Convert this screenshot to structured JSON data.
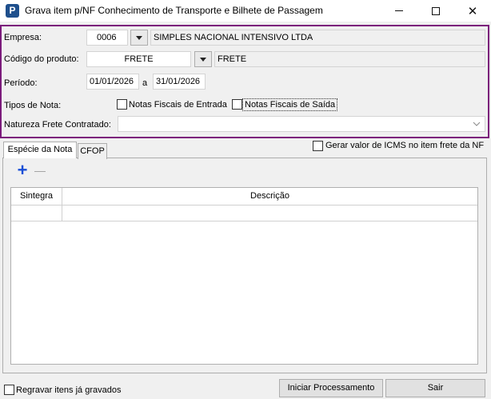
{
  "window": {
    "title": "Grava item p/NF Conhecimento de Transporte e Bilhete de Passagem",
    "icon_letter": "P"
  },
  "form": {
    "empresa_label": "Empresa:",
    "empresa_code": "0006",
    "empresa_name": "SIMPLES NACIONAL INTENSIVO LTDA",
    "produto_label": "Código do produto:",
    "produto_code": "FRETE",
    "produto_name": "FRETE",
    "periodo_label": "Período:",
    "periodo_start": "01/01/2026",
    "periodo_sep": "a",
    "periodo_end": "31/01/2026",
    "tipos_label": "Tipos de Nota:",
    "nf_entrada_label": "Notas Fiscais de Entrada",
    "nf_entrada_checked": false,
    "nf_saida_label": "Notas Fiscais de Saída",
    "nf_saida_checked": false,
    "natureza_label": "Natureza Frete Contratado:",
    "natureza_value": ""
  },
  "tabs": [
    {
      "label": "Espécie da Nota",
      "active": true
    },
    {
      "label": "CFOP",
      "active": false
    }
  ],
  "gerar_icms_label": "Gerar valor de ICMS no item frete da NF",
  "gerar_icms_checked": false,
  "toolbar": {
    "add_symbol": "+",
    "remove_symbol": "—"
  },
  "grid": {
    "columns": [
      "Sintegra",
      "Descrição"
    ],
    "rows": [
      [
        "",
        ""
      ]
    ]
  },
  "footer": {
    "regravar_label": "Regravar itens já gravados",
    "regravar_checked": false,
    "iniciar_label": "Iniciar Processamento",
    "sair_label": "Sair"
  },
  "colors": {
    "panel_border": "#7b1a7b",
    "add_icon": "#1a4fd6",
    "app_icon_bg": "#1e4f8c"
  }
}
